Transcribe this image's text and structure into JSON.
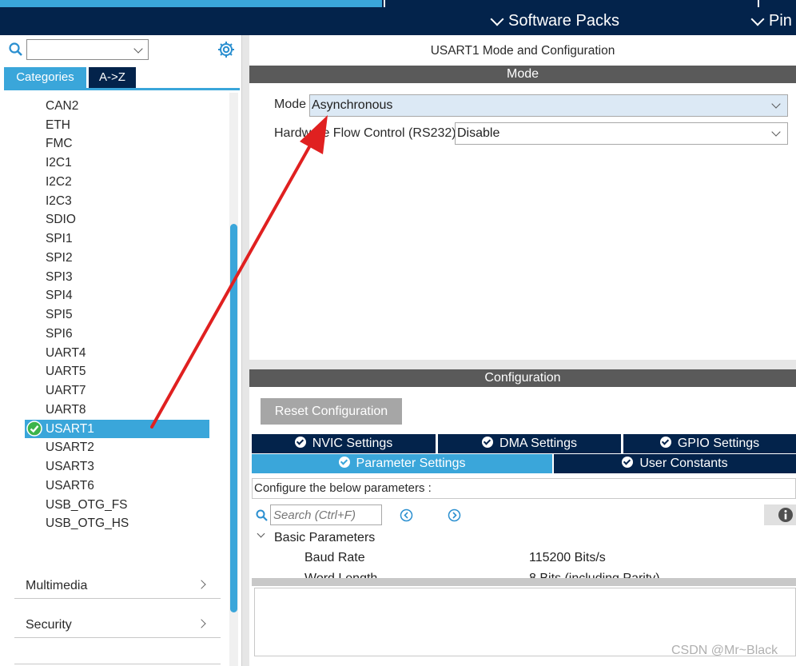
{
  "top_menu": {
    "software_packs": "Software Packs",
    "pinout": "Pin"
  },
  "left_panel": {
    "tabs": [
      "Categories",
      "A->Z"
    ],
    "items": [
      "CAN2",
      "ETH",
      "FMC",
      "I2C1",
      "I2C2",
      "I2C3",
      "SDIO",
      "SPI1",
      "SPI2",
      "SPI3",
      "SPI4",
      "SPI5",
      "SPI6",
      "UART4",
      "UART5",
      "UART7",
      "UART8",
      "USART1",
      "USART2",
      "USART3",
      "USART6",
      "USB_OTG_FS",
      "USB_OTG_HS"
    ],
    "selected_item": "USART1",
    "groups": [
      "Multimedia",
      "Security"
    ]
  },
  "right_panel": {
    "title": "USART1 Mode and Configuration",
    "mode_section": "Mode",
    "mode_label": "Mode",
    "mode_value": "Asynchronous",
    "hw_flow_label": "Hardware Flow Control (RS232)",
    "hw_flow_value": "Disable",
    "config_section": "Configuration",
    "reset_button": "Reset Configuration",
    "tabs_row1": [
      "NVIC Settings",
      "DMA Settings",
      "GPIO Settings"
    ],
    "tabs_row2": [
      "Parameter Settings",
      "User Constants"
    ],
    "configure_hint": "Configure the below parameters :",
    "search_placeholder": "Search (Ctrl+F)",
    "basic_params_header": "Basic Parameters",
    "params": [
      {
        "name": "Baud Rate",
        "value": "115200 Bits/s"
      },
      {
        "name": "Word Length",
        "value": "8 Bits (including Parity)"
      }
    ]
  },
  "watermark": "CSDN @Mr~Black",
  "colors": {
    "navy": "#03234b",
    "accent": "#3aa6da",
    "section_gray": "#5a5a5a",
    "arrow_red": "#e02020"
  }
}
